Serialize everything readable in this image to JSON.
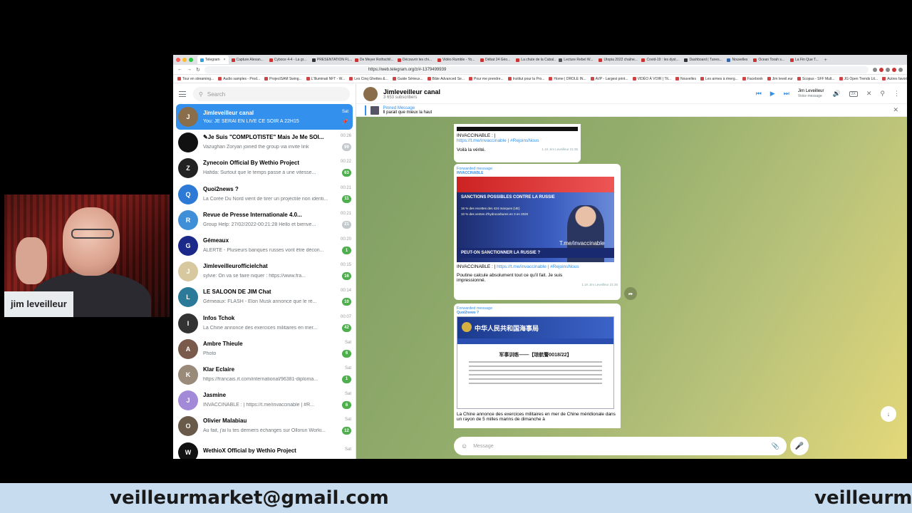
{
  "webcam": {
    "name": "jim leveilleur"
  },
  "browser": {
    "tabs": [
      {
        "label": "Telegram",
        "active": true
      },
      {
        "label": "Capture Alexan..."
      },
      {
        "label": "Cyboce 4-4 - La gr..."
      },
      {
        "label": "PRESENTATION FL..."
      },
      {
        "label": "De Meyer Rothschil..."
      },
      {
        "label": "Découvrir les chi..."
      },
      {
        "label": "Vidéo Rumble - Yo..."
      },
      {
        "label": "Débat 24 Géo..."
      },
      {
        "label": "La chute de la Cabal..."
      },
      {
        "label": "Lecture Rebel W..."
      },
      {
        "label": "Utopia 2022 chaîne..."
      },
      {
        "label": "Covid-19 : les dyst..."
      },
      {
        "label": "Dashboard | Tunes..."
      },
      {
        "label": "Nouvelles"
      },
      {
        "label": "Ocean Torah s..."
      },
      {
        "label": "La Fin Que T..."
      }
    ],
    "url": "https://web.telegram.org/z/#-1379499939",
    "bookmarks": [
      "Tour en streaming...",
      "Audio samples - Prod...",
      "ProjectSAM Swing...",
      "L'Illuminati NFT - W...",
      "Les Cinq Ghettes &...",
      "Guide Sérieux...",
      "Bâte Advanced Se...",
      "Pour me prendre...",
      "Institut pour la Pro...",
      "Home | DROLE IN...",
      "AVP - Largest print...",
      "VIDÉO À VOIR | Tit...",
      "Nouvelles",
      "Les armes à énerg...",
      "Facebook",
      "Jim leveil.eur",
      "Scopus - SFF Mult...",
      "JG Open Trends Lit...",
      "Autres favoris"
    ]
  },
  "sidebar": {
    "search_placeholder": "Search",
    "chats": [
      {
        "name": "Jimleveilleur canal",
        "preview": "You: JE SERAI EN LIVE CE SOIR A 22H15",
        "time": "Sat",
        "badge": "",
        "active": true,
        "color": "#8a6d4a",
        "initial": "J"
      },
      {
        "name": "✎Je Suis \"COMPLOTISTE\" Mais Je Me SOI...",
        "preview": "Vazughan Zoryan joined the group via invite link",
        "time": "00:26",
        "badge": "99",
        "muted": true,
        "color": "#111111",
        "initial": ""
      },
      {
        "name": "Zynecoin Official By Wethio Project",
        "preview": "Hafida: Surtout que le temps passe à une vitesse...",
        "time": "00:22",
        "badge": "63",
        "color": "#222222",
        "initial": "Z"
      },
      {
        "name": "Quoi2news ?",
        "preview": "La Corée Du Nord vient de tirer un projectile non identi...",
        "time": "00:21",
        "badge": "11",
        "color": "#2c7ad6",
        "initial": "Q"
      },
      {
        "name": "Revue de Presse Internationale 4.0...",
        "preview": "Group Help: 27/02/2022-00:21:28 Hello et bienve...",
        "time": "00:21",
        "badge": "21",
        "muted": true,
        "color": "#3f8fd8",
        "initial": "R"
      },
      {
        "name": "Gémeaux",
        "preview": "ALERTE - Plusieurs banques russes vont être décon...",
        "time": "00:20",
        "badge": "1",
        "color": "#1b2a8a",
        "initial": "G"
      },
      {
        "name": "Jimleveilleurofficielchat",
        "preview": "sylvie: On va se faire niquer : https://www.fra...",
        "time": "00:15",
        "badge": "16",
        "color": "#d8c8a0",
        "initial": "J"
      },
      {
        "name": "LE SALOON DE JIM Chat",
        "preview": "Gémeaux: FLASH - Elon Musk annonce que le ré...",
        "time": "00:14",
        "badge": "10",
        "color": "#2b7a9a",
        "initial": "L"
      },
      {
        "name": "Infos Tchok",
        "preview": "La Chine annonce des exercices militaires en mer...",
        "time": "00:07",
        "badge": "42",
        "color": "#333333",
        "initial": "I"
      },
      {
        "name": "Ambre Thieule",
        "preview": "Photo",
        "time": "Sat",
        "badge": "6",
        "color": "#7a5a4a",
        "initial": "A"
      },
      {
        "name": "Klar Eclaire",
        "preview": "https://francais.rt.com/international/96381-diploma...",
        "time": "Sat",
        "badge": "1",
        "color": "#9a8a7a",
        "initial": "K"
      },
      {
        "name": "Jasmine",
        "preview": "INVACCINABLE : | https://t.me/invaccinable | #R...",
        "time": "Sat",
        "badge": "6",
        "color": "#a28ad8",
        "initial": "J"
      },
      {
        "name": "Olivier Malabiau",
        "preview": "Au fait, j'ai lu tes derniers échanges sur Ollorun Worki...",
        "time": "Sat",
        "badge": "12",
        "color": "#6a5a4a",
        "initial": "O"
      },
      {
        "name": "WethioX Official by Wethio Project",
        "preview": "",
        "time": "Sat",
        "badge": "",
        "muted": true,
        "color": "#111111",
        "initial": "W"
      }
    ]
  },
  "header": {
    "title": "Jimleveilleur canal",
    "subtitle": "3 653 subscribers",
    "voice_title": "Jim Leveilleur",
    "voice_sub": "Voice message",
    "speed": "2X"
  },
  "pinned": {
    "title": "Pinned Message",
    "text": "Il parait que mieux la haut"
  },
  "messages": {
    "m1": {
      "text_a": "INVACCINABLE : |",
      "link": "https://t.me/invaccinable | #RejoinsNous",
      "text_b": "Voilà la vérité.",
      "meta": "1.1K   Jim Leveilleur 21:35"
    },
    "m2": {
      "fwd": "Forwarded message",
      "src": "INVACCINABLE",
      "headline": "SANCTIONS POSSIBLES CONTRE LA RUSSIE",
      "line1": "16 % des recettes des 424 marques (UE)",
      "line2": "10 % des ventes d'hydrocarbures en 3 en 2020",
      "lower": "PEUT-ON SANCTIONNER LA RUSSIE ?",
      "tme": "T.me/invaccinable",
      "text_a": "INVACCINABLE : |",
      "link": "https://t.me/invaccinable | #RejoinsNous",
      "text_b": "Poutine calcule absolument tout ce qu'il fait. Je suis impressionné.",
      "meta": "1.1K   Jim Leveilleur 21:35"
    },
    "m3": {
      "fwd": "Forwarded message",
      "src": "Quoi2news ?",
      "doc_top": "中华人民共和国海事局",
      "doc_title": "军事训练——【琼航警0018/22】",
      "text": "La Chine annonce des exercices militaires en mer de Chine méridionale dans un rayon de 5 milles marins de dimanche à"
    }
  },
  "composer": {
    "placeholder": "Message"
  },
  "banner": {
    "text1": "veilleurmarket@gmail.com",
    "text2": "veilleurma"
  }
}
